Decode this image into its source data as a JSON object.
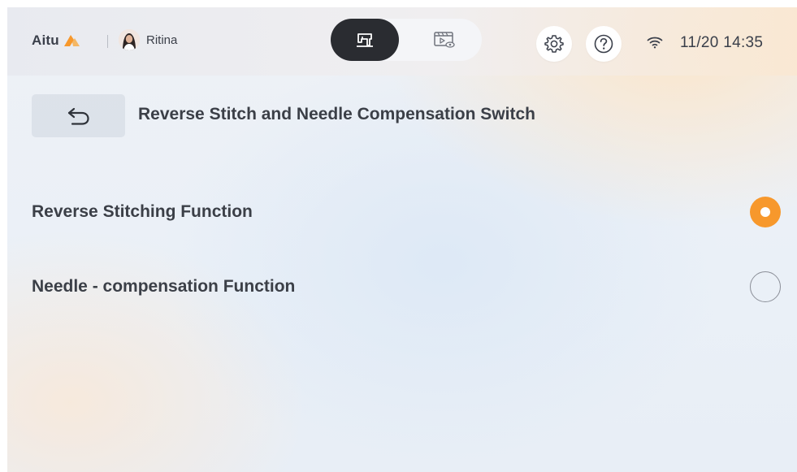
{
  "header": {
    "brand": "Aitu",
    "brand_accent": "#f7982c",
    "user_name": "Ritina",
    "mode_switch": {
      "active_icon": "sewing-machine-icon",
      "inactive_icon": "video-preview-icon"
    },
    "settings_icon": "gear-icon",
    "help_icon": "question-mark-icon",
    "wifi_icon": "wifi-icon",
    "datetime": "11/20 14:35"
  },
  "page": {
    "back_icon": "undo-arrow-icon",
    "title": "Reverse Stitch and Needle Compensation Switch"
  },
  "options": [
    {
      "label": "Reverse Stitching Function",
      "selected": true
    },
    {
      "label": "Needle - compensation Function",
      "selected": false
    }
  ],
  "colors": {
    "accent": "#f7982c",
    "active_mode_bg": "#2a2c31"
  }
}
